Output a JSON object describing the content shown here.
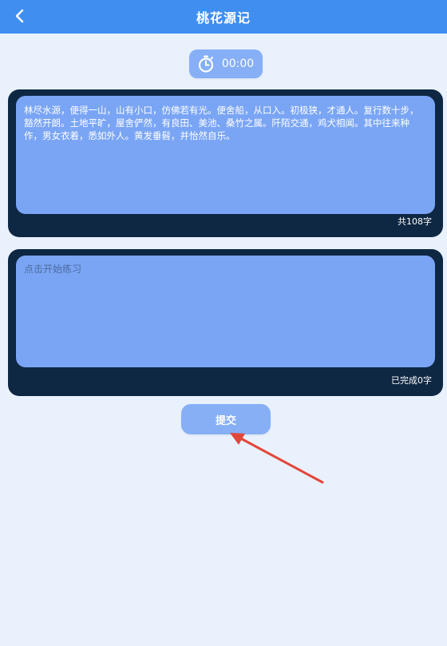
{
  "header": {
    "title": "桃花源记",
    "back_icon": "chevron-left-icon"
  },
  "timer": {
    "icon": "stopwatch-icon",
    "value": "00:00"
  },
  "source": {
    "text": "林尽水源，便得一山，山有小口，仿佛若有光。便舍船，从口入。初极狭，才通人。复行数十步，豁然开朗。土地平旷，屋舍俨然，有良田、美池、桑竹之属。阡陌交通，鸡犬相闻。其中往来种作，男女衣着，悉如外人。黄发垂髫，并怡然自乐。",
    "count_label": "共108字"
  },
  "practice": {
    "placeholder": "点击开始练习",
    "value": "",
    "count_label": "已完成0字"
  },
  "actions": {
    "submit_label": "提交"
  },
  "colors": {
    "header": "#3f8ef0",
    "background": "#e9f1fd",
    "panel": "#0e2743",
    "inner": "#7aa5f5",
    "button": "#86aff6",
    "annotation_arrow": "#e2463a"
  }
}
